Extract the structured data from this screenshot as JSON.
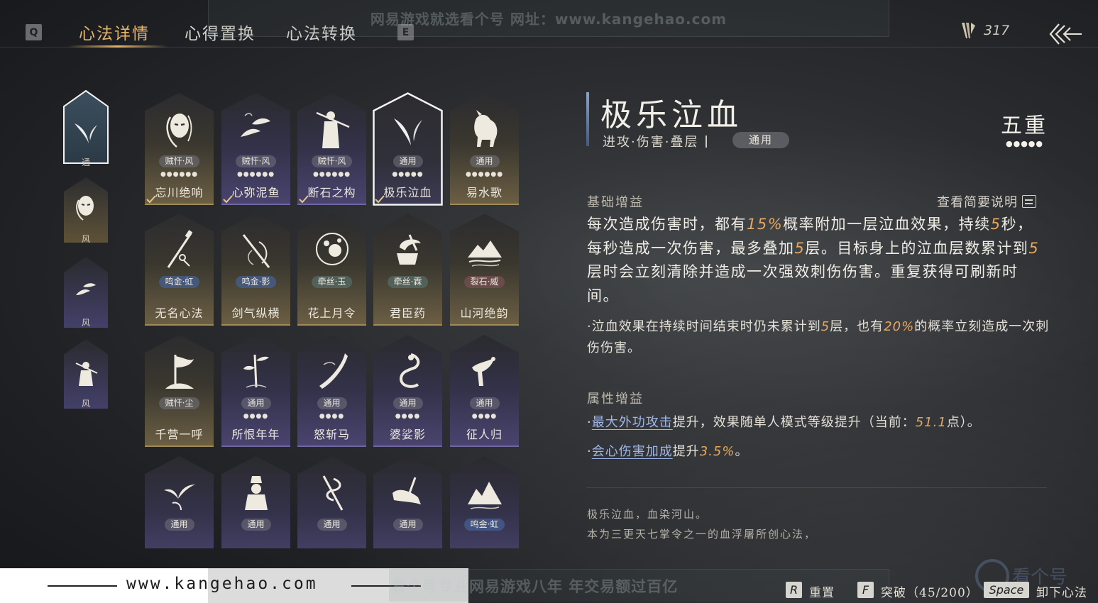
{
  "watermark": {
    "top": "网易游戏就选看个号   网址：www.kangehao.com",
    "bottom": "看个号专业网易游戏八年   年交易额过百亿",
    "url": "www.kangehao.com",
    "logo_text": "看个号"
  },
  "topbar": {
    "key_left": "Q",
    "key_right": "E",
    "tabs": [
      {
        "label": "心法详情",
        "active": true
      },
      {
        "label": "心得置换",
        "active": false
      },
      {
        "label": "心法转换",
        "active": false
      }
    ],
    "currency_value": "317",
    "accent_color": "#e4b36a"
  },
  "side_slots": [
    {
      "label": "通",
      "icon": "swallow-glyph-icon",
      "selected": true
    },
    {
      "label": "风",
      "icon": "masked-face-icon"
    },
    {
      "label": "风",
      "icon": "koi-fish-icon"
    },
    {
      "label": "风",
      "icon": "swordsman-icon"
    }
  ],
  "cards": [
    {
      "name": "忘川绝响",
      "tag": "贼忓·风",
      "dots": "●●●●●●",
      "equipped": true,
      "style": "gold",
      "icon": "masked-face-icon"
    },
    {
      "name": "心弥泥鱼",
      "tag": "贼忓·风",
      "dots": "●●●●●●",
      "equipped": true,
      "style": "purple",
      "icon": "koi-fish-icon"
    },
    {
      "name": "断石之构",
      "tag": "贼忓·风",
      "dots": "●●●●●●",
      "equipped": true,
      "style": "purple",
      "icon": "swordsman-icon"
    },
    {
      "name": "极乐泣血",
      "tag": "通用",
      "dots": "●●●●●",
      "equipped": true,
      "style": "purple",
      "icon": "swallow-glyph-icon",
      "selected": true
    },
    {
      "name": "易水歌",
      "tag": "通用",
      "dots": "●●●●●●",
      "equipped": false,
      "style": "gold",
      "icon": "white-horse-icon"
    },
    {
      "name": "无名心法",
      "tag": "鸣金·虹",
      "tag_style": "blue",
      "dots": "",
      "style": "gold",
      "icon": "sword-tassel-icon"
    },
    {
      "name": "剑气纵横",
      "tag": "鸣金·影",
      "tag_style": "blue",
      "dots": "",
      "style": "gold",
      "icon": "crossed-swords-icon"
    },
    {
      "name": "花上月令",
      "tag": "牵丝·玉",
      "tag_style": "teal",
      "dots": "",
      "style": "gold",
      "icon": "moon-flower-icon"
    },
    {
      "name": "君臣药",
      "tag": "牵丝·霖",
      "tag_style": "teal",
      "dots": "",
      "style": "gold",
      "icon": "mortar-icon"
    },
    {
      "name": "山河绝韵",
      "tag": "裂石·威",
      "tag_style": "red",
      "dots": "",
      "style": "gold",
      "icon": "mountains-icon"
    },
    {
      "name": "千营一呼",
      "tag": "贼忓·尘",
      "dots": "",
      "style": "gold",
      "icon": "war-banner-icon"
    },
    {
      "name": "所恨年年",
      "tag": "通用",
      "dots": "●●●●",
      "style": "purple",
      "icon": "bamboo-icon"
    },
    {
      "name": "怒斩马",
      "tag": "通用",
      "dots": "●●●●",
      "style": "purple",
      "icon": "blade-icon"
    },
    {
      "name": "婆娑影",
      "tag": "通用",
      "dots": "●●●●",
      "style": "purple",
      "icon": "dragon-icon"
    },
    {
      "name": "征人归",
      "tag": "通用",
      "dots": "●●●●",
      "style": "purple",
      "icon": "eagle-icon"
    },
    {
      "name": "",
      "tag": "通用",
      "dots": "",
      "style": "purple",
      "icon": "swallows-icon"
    },
    {
      "name": "",
      "tag": "通用",
      "dots": "",
      "style": "purple",
      "icon": "statue-icon"
    },
    {
      "name": "",
      "tag": "通用",
      "dots": "",
      "style": "purple",
      "icon": "snake-staff-icon"
    },
    {
      "name": "",
      "tag": "通用",
      "dots": "",
      "style": "purple",
      "icon": "broken-blade-icon"
    },
    {
      "name": "",
      "tag": "鸣金·虹",
      "tag_style": "blue",
      "dots": "",
      "style": "purple",
      "icon": "peaks-icon"
    }
  ],
  "detail": {
    "title": "极乐泣血",
    "tags": "进攻·伤害·叠层",
    "general": "通用",
    "level": "五重",
    "level_dots": "●●●●●",
    "basic_head": "基础增益",
    "brief_link": "查看简要说明",
    "desc_1": "每次造成伤害时，都有",
    "desc_hl1": "15%",
    "desc_2": "概率附加一层泣血效果，持续",
    "desc_hl2": "5",
    "desc_3": "秒，每秒造成一次伤害，最多叠加",
    "desc_hl3": "5",
    "desc_4": "层。目标身上的泣血层数累计到",
    "desc_hl4": "5",
    "desc_5": "层时会立刻清除并造成一次强效刺伤伤害。重复获得可刷新时间。",
    "sub_1": "·泣血效果在持续时间结束时仍未累计到",
    "sub_hl1": "5",
    "sub_2": "层，也有",
    "sub_hl2": "20%",
    "sub_3": "的概率立刻造成一次刺伤伤害。",
    "attr_head": "属性增益",
    "attr1_link": "最大外功攻击",
    "attr1_text": "提升，效果随单人模式等级提升（当前：",
    "attr1_val": "51.1",
    "attr1_tail": "点）。",
    "attr2_link": "会心伤害加成",
    "attr2_text": "提升",
    "attr2_val": "3.5%",
    "attr2_tail": "。",
    "lore_1": "极乐泣血，血染河山。",
    "lore_2": "本为三更天七掌令之一的血浮屠所创心法，"
  },
  "footer": {
    "reset_key": "R",
    "reset_label": "重置",
    "break_key": "F",
    "break_label": "突破（45/200）",
    "unload_key": "Space",
    "unload_label": "卸下心法"
  }
}
